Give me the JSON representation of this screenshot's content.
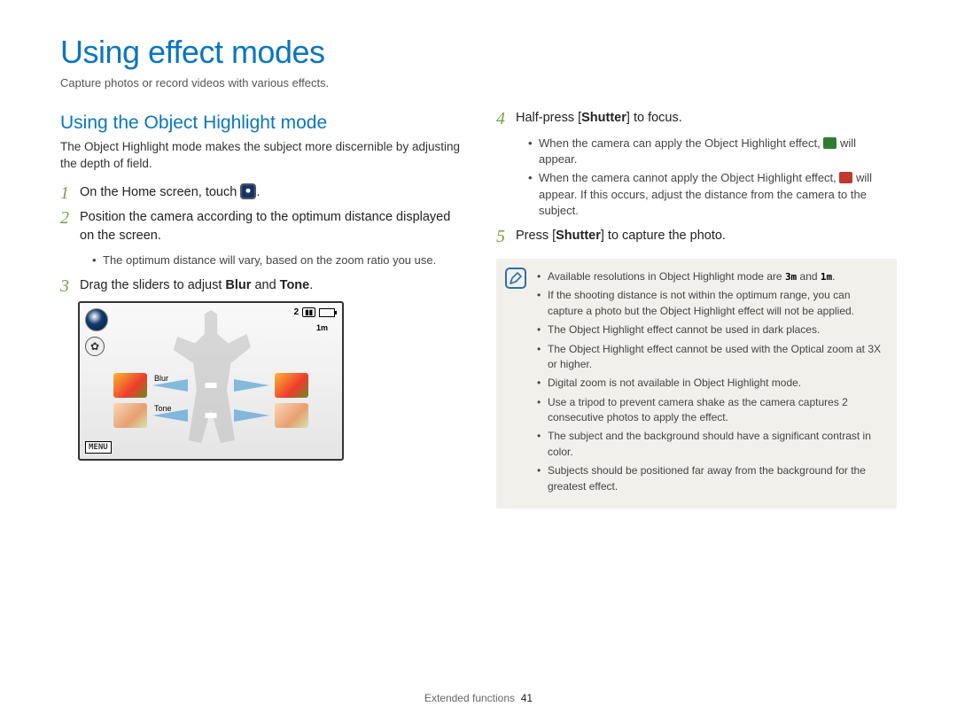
{
  "page": {
    "title": "Using effect modes",
    "subtitle": "Capture photos or record videos with various effects.",
    "footer_section": "Extended functions",
    "footer_page": "41"
  },
  "section": {
    "title": "Using the Object Highlight mode",
    "desc": "The Object Highlight mode makes the subject more discernible by adjusting the depth of field."
  },
  "steps": {
    "s1": {
      "num": "1",
      "pre": "On the Home screen, touch ",
      "post": "."
    },
    "s2": {
      "num": "2",
      "text": "Position the camera according to the optimum distance displayed on the screen.",
      "sub1": "The optimum distance will vary, based on the zoom ratio you use."
    },
    "s3": {
      "num": "3",
      "pre": "Drag the sliders to adjust ",
      "b1": "Blur",
      "mid": " and ",
      "b2": "Tone",
      "post": "."
    },
    "s4": {
      "num": "4",
      "pre": "Half-press [",
      "b": "Shutter",
      "post": "] to focus.",
      "sub1a": "When the camera can apply the Object Highlight effect, ",
      "sub1b": " will appear.",
      "sub2a": "When the camera cannot apply the Object Highlight effect, ",
      "sub2b": " will appear. If this occurs, adjust the distance from the camera to the subject."
    },
    "s5": {
      "num": "5",
      "pre": "Press [",
      "b": "Shutter",
      "post": "] to capture the photo."
    }
  },
  "screen": {
    "counter": "2",
    "res_label": "1m",
    "blur_label": "Blur",
    "tone_label": "Tone",
    "menu_label": "MENU"
  },
  "notes": {
    "n1a": "Available resolutions in Object Highlight mode are ",
    "n1_icon1": "3m",
    "n1_mid": " and ",
    "n1_icon2": "1m",
    "n1b": ".",
    "n2": "If the shooting distance is not within the optimum range, you can capture a photo but the Object Highlight effect will not be applied.",
    "n3": "The Object Highlight effect cannot be used in dark places.",
    "n4": "The Object Highlight effect cannot be used with the Optical zoom at 3X or higher.",
    "n5": "Digital zoom is not available in Object Highlight mode.",
    "n6": "Use a tripod to prevent camera shake as the camera captures 2 consecutive photos to apply the effect.",
    "n7": "The subject and the background should have a significant contrast in color.",
    "n8": "Subjects should be positioned far away from the background for the greatest effect."
  }
}
